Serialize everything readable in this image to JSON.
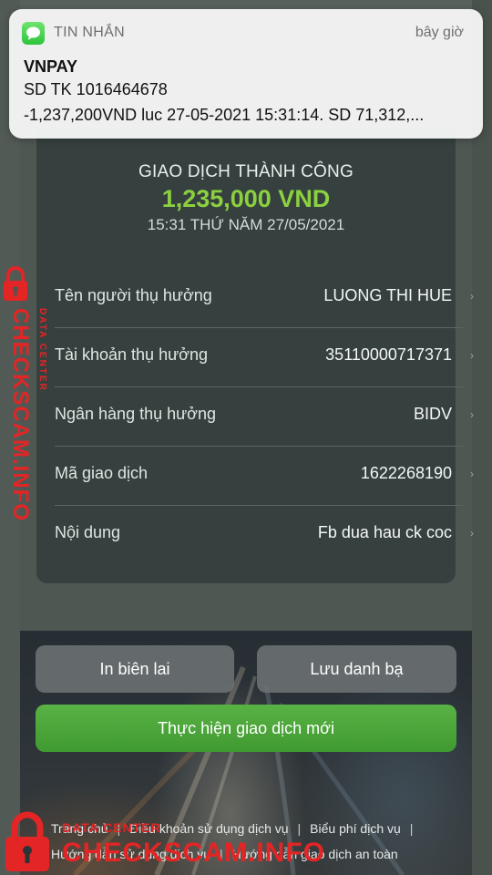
{
  "notification": {
    "app_name": "TIN NHẮN",
    "time": "bây giờ",
    "sender": "VNPAY",
    "line1": "SD TK 1016464678",
    "line2": "-1,237,200VND luc 27-05-2021 15:31:14. SD 71,312,..."
  },
  "receipt": {
    "status": "GIAO DỊCH THÀNH CÔNG",
    "amount": "1,235,000 VND",
    "datetime": "15:31 THỨ NĂM 27/05/2021",
    "rows": [
      {
        "label": "Tên người thụ hưởng",
        "value": "LUONG THI HUE"
      },
      {
        "label": "Tài khoản thụ hưởng",
        "value": "35110000717371"
      },
      {
        "label": "Ngân hàng thụ hưởng",
        "value": "BIDV"
      },
      {
        "label": "Mã giao dịch",
        "value": "1622268190"
      },
      {
        "label": "Nội dung",
        "value": "Fb dua hau ck coc"
      }
    ]
  },
  "buttons": {
    "print": "In biên lai",
    "save_contact": "Lưu danh bạ",
    "new_transaction": "Thực hiện giao dịch mới"
  },
  "footer": {
    "links_row1": [
      "Trang chủ",
      "Điều khoản sử dụng dịch vụ",
      "Biểu phí dịch vụ"
    ],
    "links_row2": [
      "Hướng dẫn sử dụng dịch vụ",
      "Hướng dẫn giao dịch an toàn"
    ]
  },
  "watermark": {
    "brand": "CHECKSCAM.INFO",
    "sub": "DATA CENTER"
  },
  "colors": {
    "amount": "#8bd13f",
    "primary_button": "#4ca83a",
    "watermark": "#e32525"
  }
}
